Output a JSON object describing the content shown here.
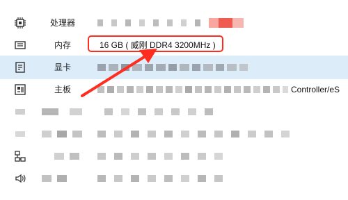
{
  "rows": [
    {
      "label": "处理器",
      "icon": "cpu-icon"
    },
    {
      "label": "内存",
      "icon": "memory-icon",
      "value": "16 GB ( 威刚 DDR4 3200MHz )"
    },
    {
      "label": "显卡",
      "icon": "gpu-icon"
    },
    {
      "label": "主板",
      "icon": "motherboard-icon",
      "value": "Controller/eS"
    },
    {
      "label": "",
      "icon": "drive-icon"
    },
    {
      "label": "",
      "icon": "monitor-icon"
    },
    {
      "label": "",
      "icon": "network-icon"
    },
    {
      "label": "",
      "icon": "speaker-icon"
    }
  ],
  "colors": {
    "selected_row": "#dcecf9",
    "highlight": "#ff2d1f"
  }
}
